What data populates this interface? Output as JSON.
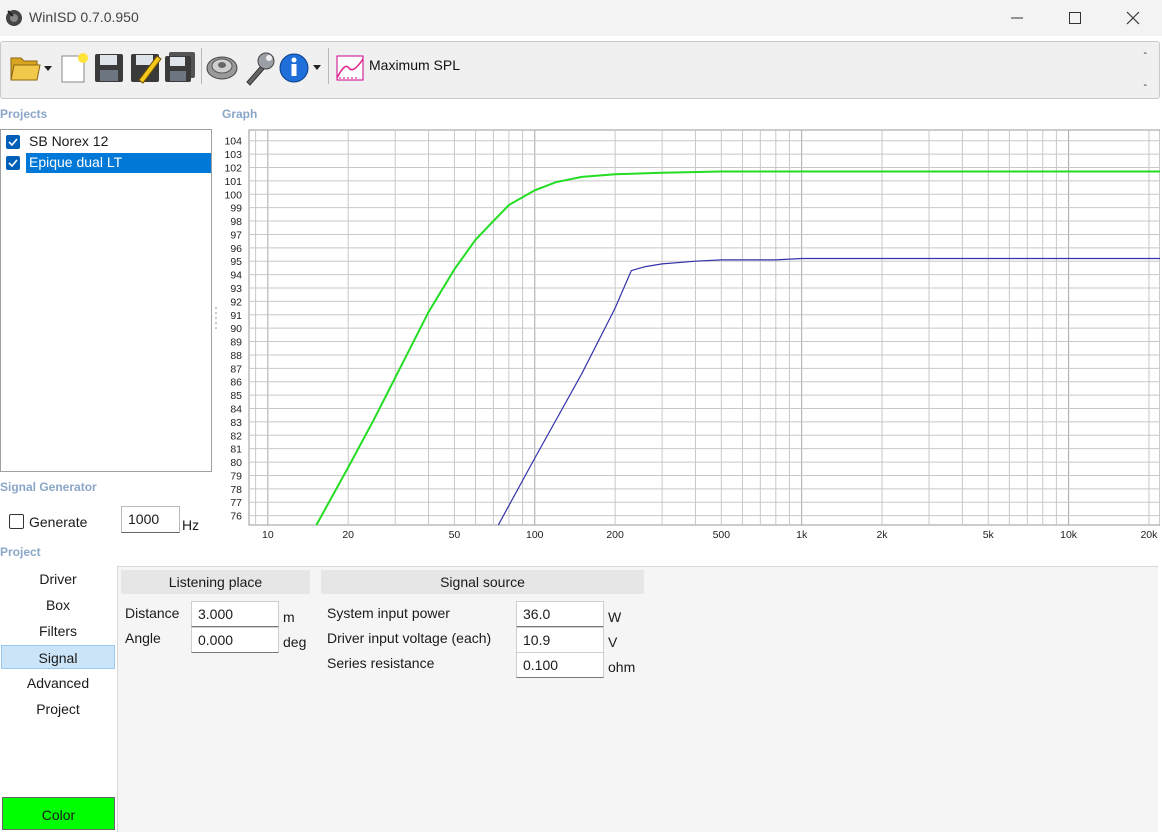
{
  "window": {
    "title": "WinISD 0.7.0.950"
  },
  "toolbar": {
    "icons": [
      "open-folder-icon",
      "new-document-icon",
      "save-icon",
      "save-as-icon",
      "save-all-icon",
      "driver-icon",
      "wrench-icon",
      "info-icon",
      "max-spl-graph-icon"
    ],
    "graph_type_label": "Maximum SPL",
    "dash_top": "-",
    "dash_bottom": "-"
  },
  "projects": {
    "label": "Projects",
    "items": [
      {
        "label": "SB Norex 12",
        "checked": true,
        "selected": false
      },
      {
        "label": "Epique dual LT",
        "checked": true,
        "selected": true
      }
    ]
  },
  "graph": {
    "label": "Graph"
  },
  "signal_generator": {
    "label": "Signal Generator",
    "generate_label": "Generate",
    "generate_checked": false,
    "frequency": "1000",
    "unit": "Hz"
  },
  "project": {
    "label": "Project",
    "nav": [
      "Driver",
      "Box",
      "Filters",
      "Signal",
      "Advanced",
      "Project"
    ],
    "active_nav": "Signal",
    "color_label": "Color",
    "color_value": "#00ff00"
  },
  "listening_place": {
    "title": "Listening place",
    "distance_label": "Distance",
    "distance_value": "3.000",
    "distance_unit": "m",
    "angle_label": "Angle",
    "angle_value": "0.000",
    "angle_unit": "deg"
  },
  "signal_source": {
    "title": "Signal source",
    "power_label": "System input power",
    "power_value": "36.0",
    "power_unit": "W",
    "voltage_label": "Driver input voltage (each)",
    "voltage_value": "10.9",
    "voltage_unit": "V",
    "resistance_label": "Series resistance",
    "resistance_value": "0.100",
    "resistance_unit": "ohm"
  },
  "chart_data": {
    "type": "line",
    "title": "",
    "xlabel": "",
    "ylabel": "",
    "xscale": "log",
    "xlim": [
      8.5,
      22000
    ],
    "ylim": [
      75.3,
      104.8
    ],
    "x_ticks": [
      10,
      20,
      50,
      100,
      200,
      500,
      1000,
      2000,
      5000,
      10000,
      20000
    ],
    "x_tick_labels": [
      "10",
      "20",
      "50",
      "100",
      "200",
      "500",
      "1k",
      "2k",
      "5k",
      "10k",
      "20k"
    ],
    "y_ticks": [
      76,
      77,
      78,
      79,
      80,
      81,
      82,
      83,
      84,
      85,
      86,
      87,
      88,
      89,
      90,
      91,
      92,
      93,
      94,
      95,
      96,
      97,
      98,
      99,
      100,
      101,
      102,
      103,
      104
    ],
    "grid": true,
    "series": [
      {
        "color": "#22dd22",
        "x": [
          15.2,
          20,
          25,
          30,
          40,
          50,
          60,
          70,
          80,
          100,
          120,
          150,
          200,
          300,
          500,
          1000,
          2000,
          5000,
          10000,
          22000
        ],
        "y": [
          75.3,
          79.6,
          83.2,
          86.3,
          91.2,
          94.4,
          96.6,
          98.0,
          99.2,
          100.3,
          100.9,
          101.3,
          101.5,
          101.6,
          101.7,
          101.7,
          101.7,
          101.7,
          101.7,
          101.7
        ]
      },
      {
        "color": "#3333aa",
        "x": [
          73,
          100,
          150,
          200,
          230,
          260,
          300,
          400,
          500,
          800,
          1000,
          2000,
          5000,
          10000,
          22000
        ],
        "y": [
          75.3,
          80.3,
          86.6,
          91.5,
          94.3,
          94.6,
          94.8,
          95.0,
          95.1,
          95.1,
          95.2,
          95.2,
          95.2,
          95.2,
          95.2
        ]
      }
    ]
  }
}
